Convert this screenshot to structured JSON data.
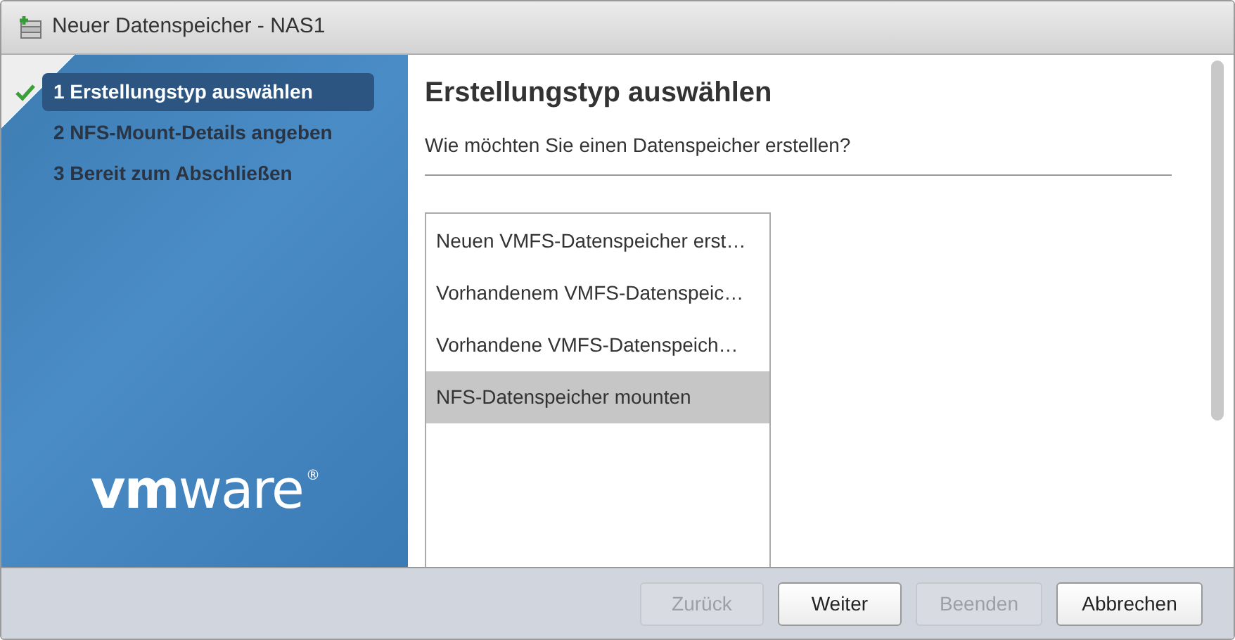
{
  "window": {
    "title": "Neuer Datenspeicher - NAS1"
  },
  "steps": [
    {
      "label": "1 Erstellungstyp auswählen",
      "selected": true,
      "completed": true
    },
    {
      "label": "2 NFS-Mount-Details angeben",
      "selected": false,
      "completed": false
    },
    {
      "label": "3 Bereit zum Abschließen",
      "selected": false,
      "completed": false
    }
  ],
  "logo": "**vm**ware",
  "logo_mark": "®",
  "page": {
    "title": "Erstellungstyp auswählen",
    "question": "Wie möchten Sie einen Datenspeicher erstellen?"
  },
  "options": [
    {
      "label": "Neuen VMFS-Datenspeicher erst…",
      "selected": false
    },
    {
      "label": "Vorhandenem VMFS-Datenspeic…",
      "selected": false
    },
    {
      "label": "Vorhandene VMFS-Datenspeich…",
      "selected": false
    },
    {
      "label": "NFS-Datenspeicher mounten",
      "selected": true
    }
  ],
  "buttons": [
    {
      "label": "Zurück",
      "disabled": true
    },
    {
      "label": "Weiter",
      "disabled": false
    },
    {
      "label": "Beenden",
      "disabled": true
    },
    {
      "label": "Abbrechen",
      "disabled": false
    }
  ]
}
